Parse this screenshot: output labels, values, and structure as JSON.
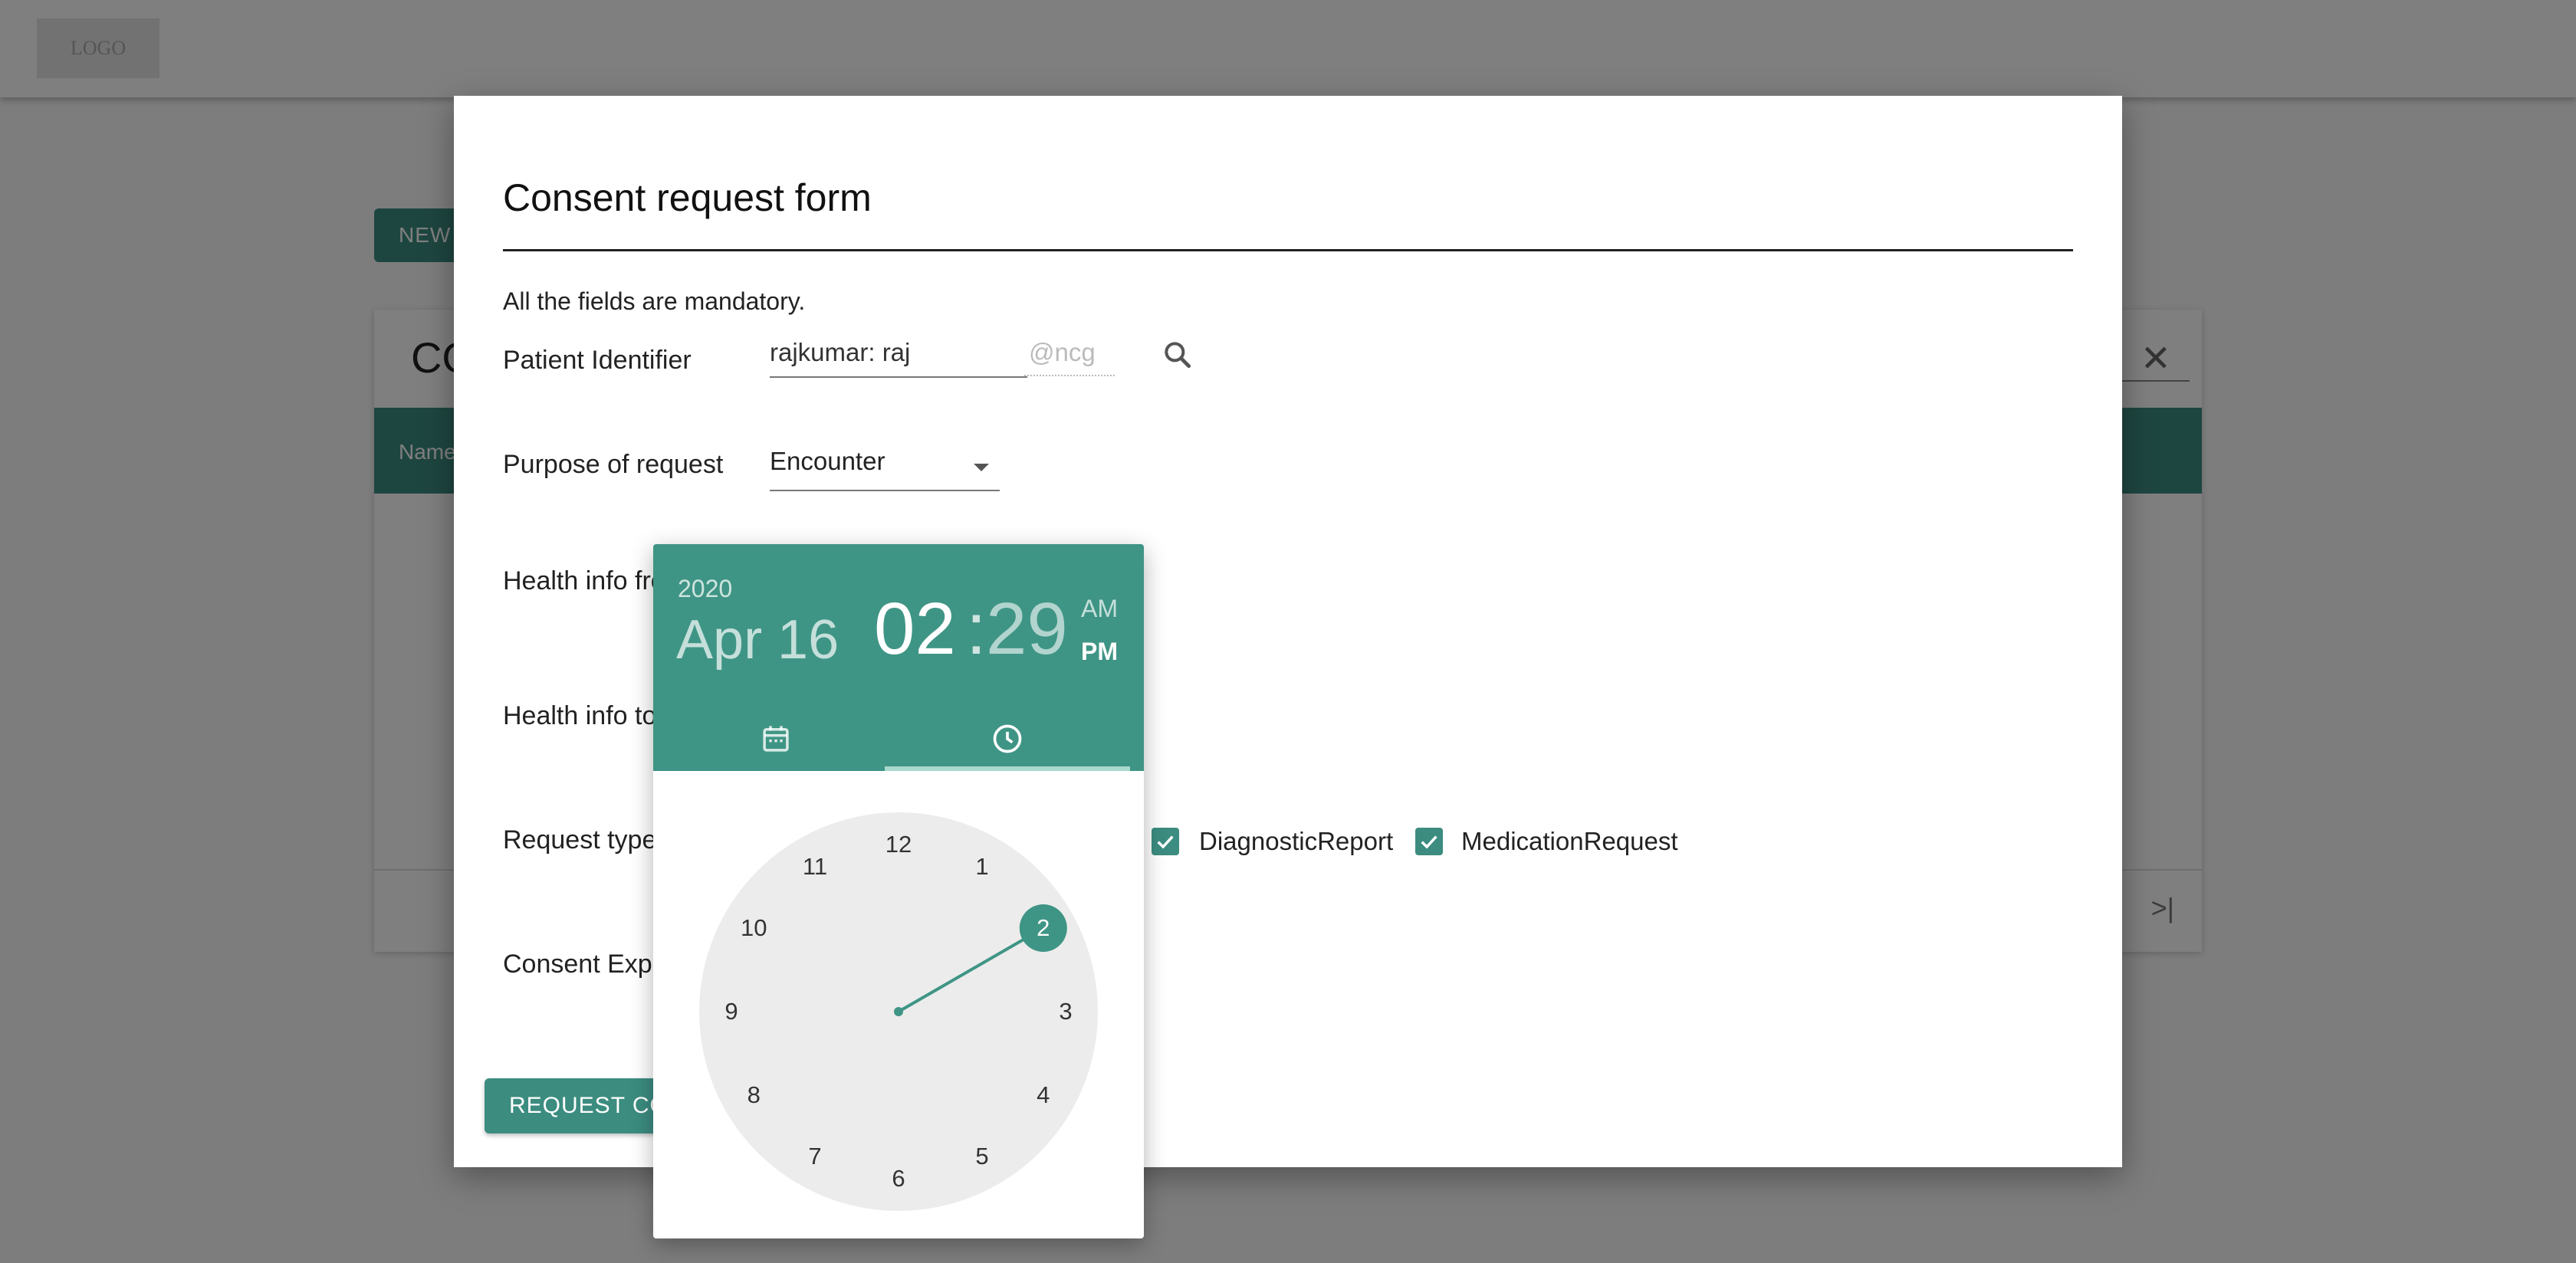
{
  "app": {
    "logo_text": "LOGO",
    "new_button_label": "NEW",
    "card_title": "CO",
    "table_header_first": "Name"
  },
  "dialog": {
    "title": "Consent request form",
    "mandatory_note": "All the fields are mandatory.",
    "labels": {
      "patient_identifier": "Patient Identifier",
      "purpose": "Purpose of request",
      "health_from": "Health info fro",
      "health_to": "Health info to",
      "request_type": "Request type",
      "consent_expiry": "Consent Expir"
    },
    "patient_identifier_value": "rajkumar: raj",
    "patient_identifier_suffix": "@ncg",
    "purpose_value": "Encounter",
    "request_types": [
      {
        "label": "DiagnosticReport",
        "checked": true
      },
      {
        "label": "MedicationRequest",
        "checked": true
      }
    ],
    "submit_label": "REQUEST CONSENT"
  },
  "picker": {
    "year": "2020",
    "date": "Apr 16",
    "hour": "02",
    "separator": ":",
    "minute": "29",
    "am": "AM",
    "pm": "PM",
    "selected_period": "PM",
    "selected_hour": 2,
    "clock_numbers": [
      "12",
      "1",
      "2",
      "3",
      "4",
      "5",
      "6",
      "7",
      "8",
      "9",
      "10",
      "11"
    ],
    "accent_color": "#3f9585"
  }
}
